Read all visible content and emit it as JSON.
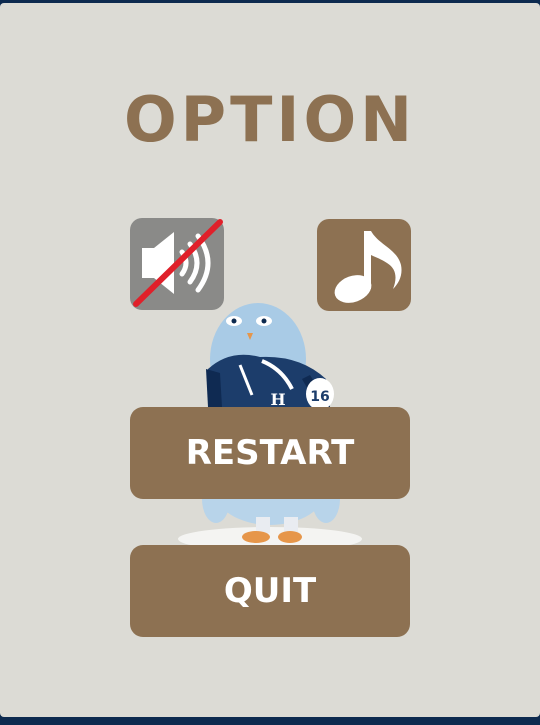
{
  "screen": {
    "title": "OPTION"
  },
  "controls": {
    "sound": {
      "icon": "speaker-muted-icon",
      "state": "muted",
      "bg_color": "#8a8a88"
    },
    "music": {
      "icon": "music-note-icon",
      "state": "on",
      "bg_color": "#8d7152"
    }
  },
  "menu": {
    "restart_label": "RESTART",
    "quit_label": "QUIT"
  },
  "mascot": {
    "icon": "bird-mascot-icon",
    "jersey_number": "16",
    "jersey_letter": "H"
  },
  "colors": {
    "accent": "#8d7152",
    "background": "#dcdbd5",
    "frame": "#0d2a4f",
    "mute_slash": "#e0202a"
  }
}
